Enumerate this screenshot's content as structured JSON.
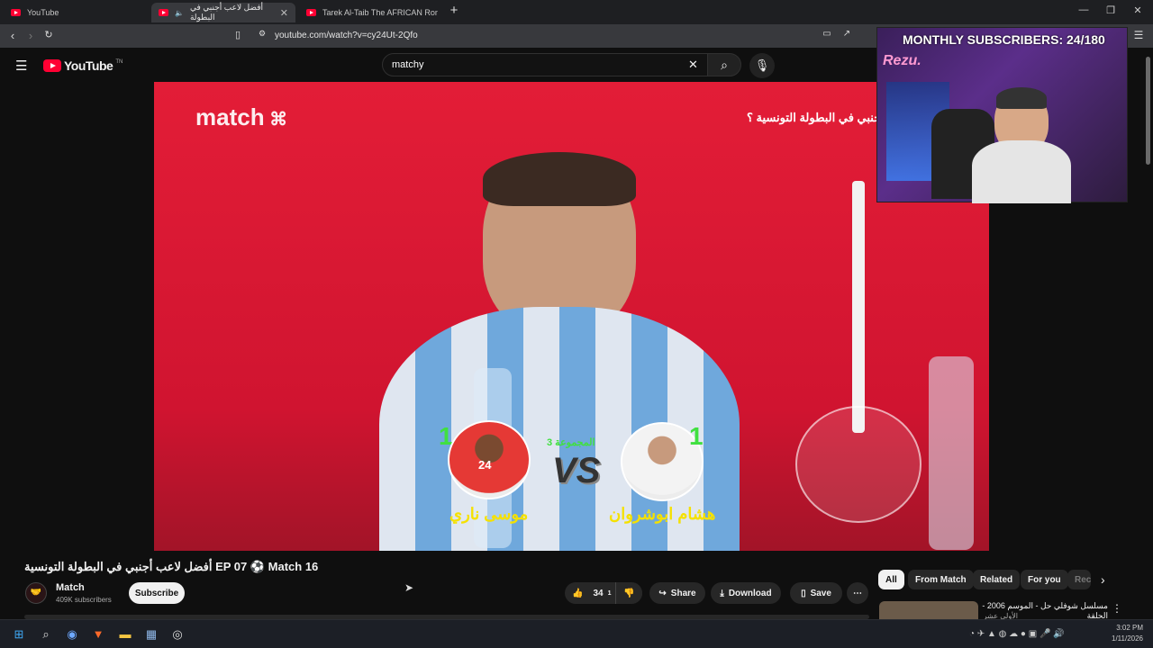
{
  "tabs": [
    {
      "label": "YouTube"
    },
    {
      "label": "أفضل لاعب أجنبي في البطولة"
    },
    {
      "label": "Tarek Al-Taib The AFRICAN Ronaldin"
    }
  ],
  "browser": {
    "url": "youtube.com/watch?v=cy24Ut-2Qfo"
  },
  "youtube": {
    "logo": "YouTube",
    "region": "TN",
    "search_value": "matchy"
  },
  "video": {
    "channel_watermark": "match",
    "question": "جنبي في البطولة التونسية ؟",
    "group_label": "المجموعة 3",
    "vs": "VS",
    "left_player": {
      "name": "موسى ناري",
      "score": "1",
      "jersey": "24"
    },
    "right_player": {
      "name": "هشام ابوشروان",
      "score": "1"
    }
  },
  "overlay": {
    "subscribers_text": "MONTHLY SUBSCRIBERS: 24/180",
    "streamer_logo": "Rezu."
  },
  "watch": {
    "title": "أفضل لاعب أجنبي في البطولة التونسية EP 07 ⚽ Match 16",
    "channel_name": "Match",
    "subscribers": "409K subscribers",
    "subscribe_label": "Subscribe",
    "like_count": "34",
    "like_superscript": "1",
    "share_label": "Share",
    "download_label": "Download",
    "save_label": "Save"
  },
  "chips": [
    {
      "label": "All",
      "active": true
    },
    {
      "label": "From Match"
    },
    {
      "label": "Related"
    },
    {
      "label": "For you"
    },
    {
      "label": "Rec"
    }
  ],
  "recommended": [
    {
      "title": "مسلسل شوفلي حل - الموسم 2006 - الحلقة",
      "subtitle": "الأولى عشر"
    }
  ],
  "taskbar": {
    "time": "3:02 PM",
    "date": "1/11/2026"
  },
  "colors": {
    "youtube_red": "#ff0033",
    "video_bg": "#e31d37",
    "score_green": "#40e040",
    "name_yellow": "#f5e100"
  }
}
